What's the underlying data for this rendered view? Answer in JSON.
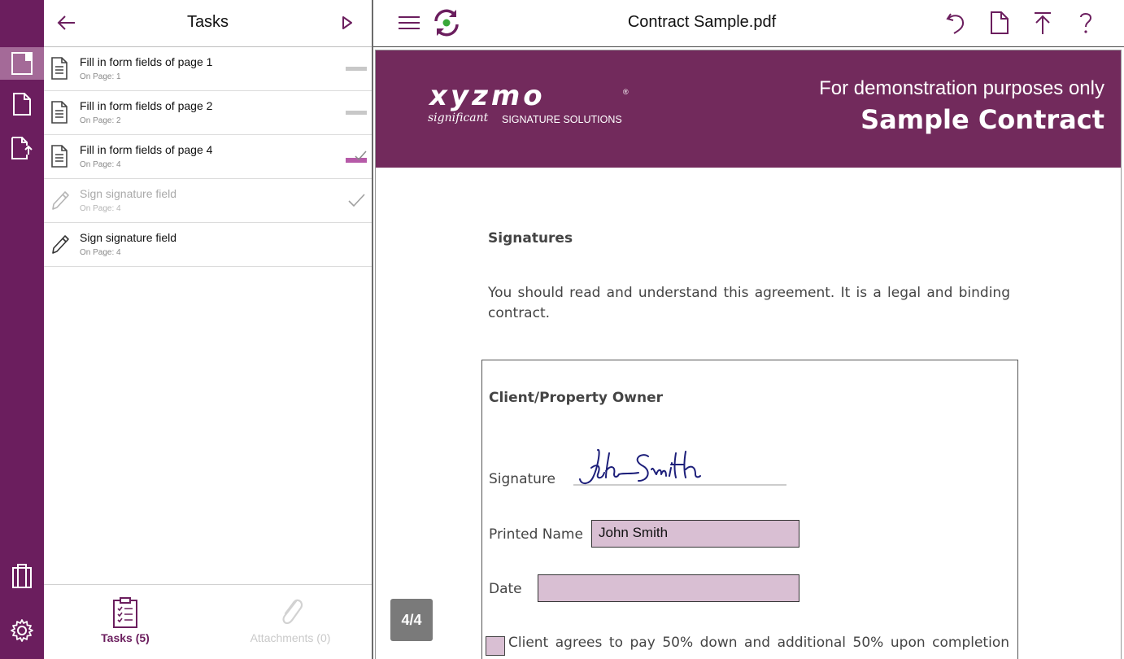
{
  "tasks_panel": {
    "title": "Tasks",
    "items": [
      {
        "name": "Fill in form fields of page 1",
        "page": "On Page: 1",
        "icon": "form-document-icon",
        "status": "pending"
      },
      {
        "name": "Fill in form fields of page 2",
        "page": "On Page: 2",
        "icon": "form-document-icon",
        "status": "pending"
      },
      {
        "name": "Fill in form fields of page 4",
        "page": "On Page: 4",
        "icon": "form-document-icon",
        "status": "active"
      },
      {
        "name": "Sign signature field",
        "page": "On Page: 4",
        "icon": "pencil-icon",
        "status": "done"
      },
      {
        "name": "Sign signature field",
        "page": "On Page: 4",
        "icon": "pencil-icon",
        "status": "none"
      }
    ],
    "footer": {
      "tasks_label": "Tasks (5)",
      "attachments_label": "Attachments (0)"
    }
  },
  "document": {
    "title": "Contract Sample.pdf",
    "page_indicator": "4/4",
    "banner": {
      "logo_text": "xyzmo",
      "logo_reg": "®",
      "logo_sub_script": "significant",
      "logo_sub_caps": "SIGNATURE SOLUTIONS",
      "note": "For demonstration purposes only",
      "title": "Sample Contract"
    },
    "heading": "Signatures",
    "agreement_text": "You should read and understand this agreement. It is a legal and binding contract.",
    "owner_section": {
      "title": "Client/Property Owner",
      "signature_label": "Signature",
      "signature_value": "John Smith",
      "printed_name_label": "Printed Name",
      "printed_name_value": "John Smith",
      "date_label": "Date",
      "date_value": "",
      "clause_text": "Client agrees to pay 50% down and additional 50% upon completion"
    }
  },
  "colors": {
    "brand": "#6b1e5e",
    "banner": "#722a5c",
    "accent_green": "#3aa83a",
    "field_fill": "#d9bfd3",
    "signature_ink": "#1d1f7a"
  }
}
